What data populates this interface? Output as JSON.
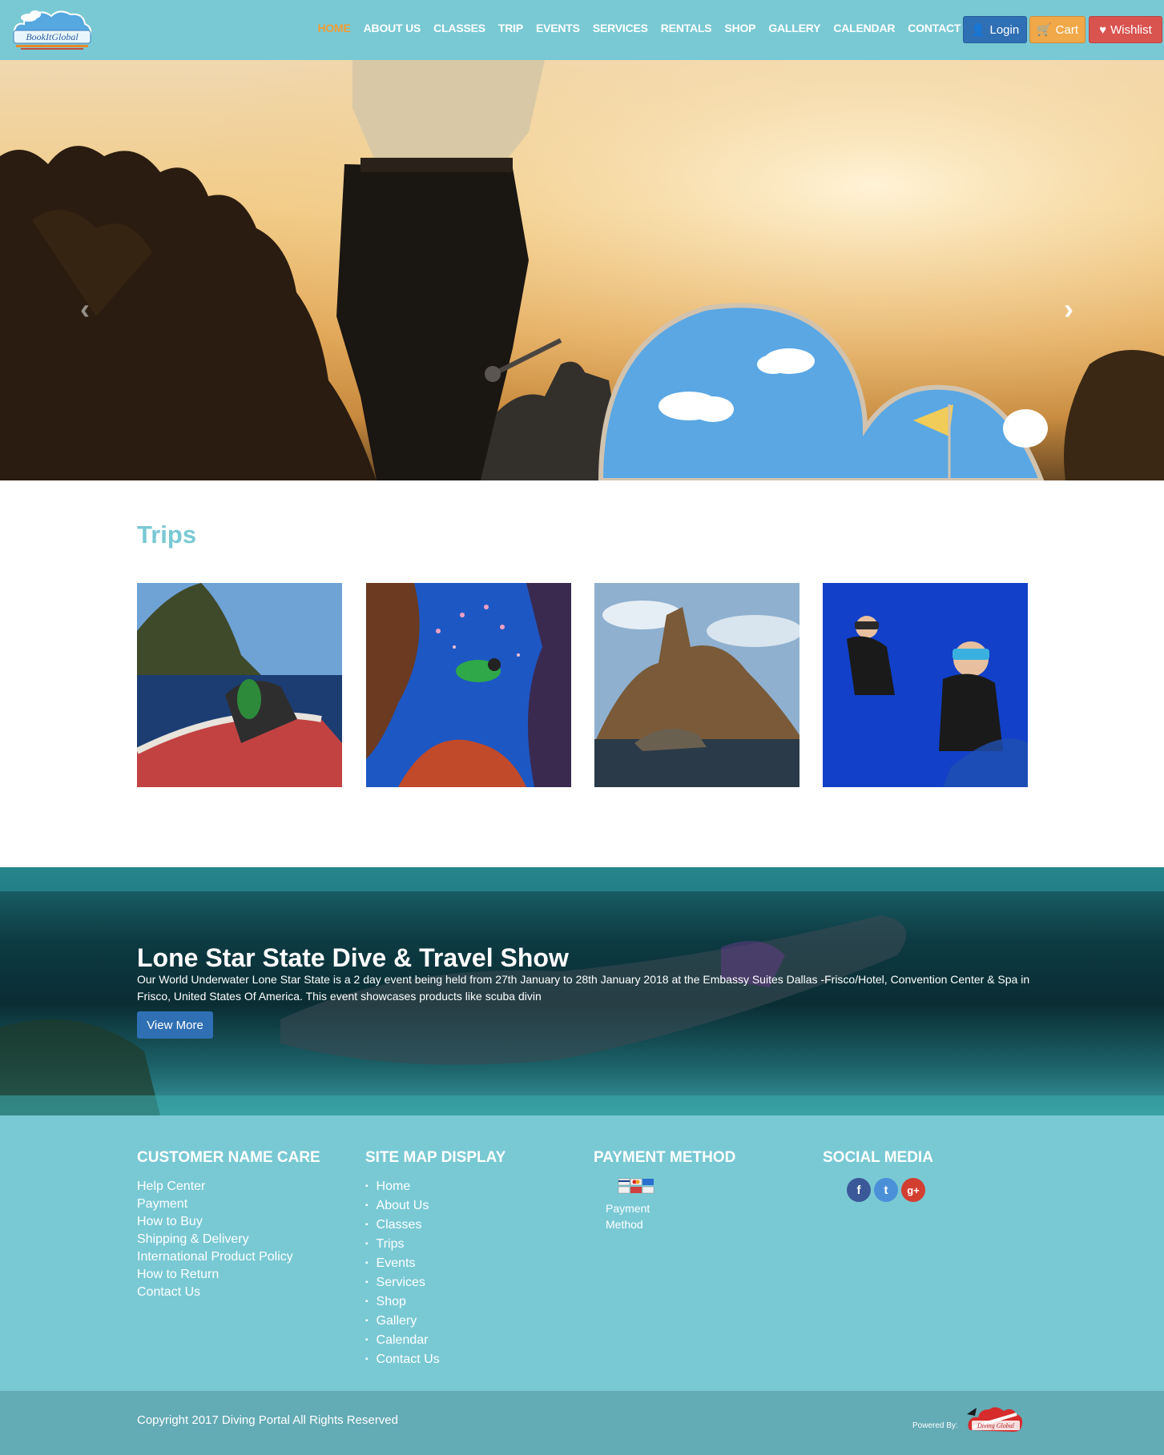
{
  "brand": {
    "logo_text": "BookItGlobal"
  },
  "nav": {
    "items": [
      {
        "label": "HOME",
        "active": true
      },
      {
        "label": "ABOUT US",
        "active": false
      },
      {
        "label": "CLASSES",
        "active": false
      },
      {
        "label": "TRIP",
        "active": false
      },
      {
        "label": "EVENTS",
        "active": false
      },
      {
        "label": "SERVICES",
        "active": false
      },
      {
        "label": "RENTALS",
        "active": false
      },
      {
        "label": "SHOP",
        "active": false
      },
      {
        "label": "GALLERY",
        "active": false
      },
      {
        "label": "CALENDAR",
        "active": false
      },
      {
        "label": "CONTACT US",
        "active": false
      }
    ],
    "login_label": "Login",
    "cart_label": "Cart",
    "wishlist_label": "Wishlist"
  },
  "hero": {
    "prev_icon": "chevron-left-icon",
    "next_icon": "chevron-right-icon",
    "slide_count": 4,
    "active_slide": 1
  },
  "trips": {
    "title": "Trips",
    "items": [
      {
        "image": "boat-cliff-photo"
      },
      {
        "image": "coral-reef-diver-photo"
      },
      {
        "image": "rocky-island-photo"
      },
      {
        "image": "two-divers-photo"
      }
    ]
  },
  "event": {
    "title": "Lone Star State Dive & Travel Show",
    "description": "Our World Underwater Lone Star State is a 2 day event being held from 27th January to 28th January 2018 at the Embassy Suites Dallas -Frisco/Hotel, Convention Center & Spa in Frisco, United States Of America. This event showcases products like scuba divin",
    "button_label": "View More"
  },
  "footer": {
    "customer_care": {
      "title": "CUSTOMER NAME CARE",
      "links": [
        "Help Center",
        "Payment",
        "How to Buy",
        "Shipping & Delivery",
        "International Product Policy",
        "How to Return",
        "Contact Us"
      ]
    },
    "sitemap": {
      "title": "SITE MAP DISPLAY",
      "links": [
        "Home",
        "About Us",
        "Classes",
        "Trips",
        "Events",
        "Services",
        "Shop",
        "Gallery",
        "Calendar",
        "Contact Us"
      ]
    },
    "payment": {
      "title": "PAYMENT METHOD",
      "image_alt": "Payment Method"
    },
    "social": {
      "title": "SOCIAL MEDIA",
      "networks": [
        "f",
        "t",
        "g+"
      ]
    }
  },
  "copyright": {
    "text": "Copyright 2017 Diving Portal All Rights Reserved",
    "powered_by": "Powered By:",
    "powered_logo": "Diving Global"
  },
  "colors": {
    "header_bg": "#79c9d4",
    "nav_active": "#f39c34",
    "login_btn": "#2f6fb4",
    "cart_btn": "#f0a848",
    "wishlist_btn": "#d9534f",
    "copyright_bg": "#63abb5"
  }
}
